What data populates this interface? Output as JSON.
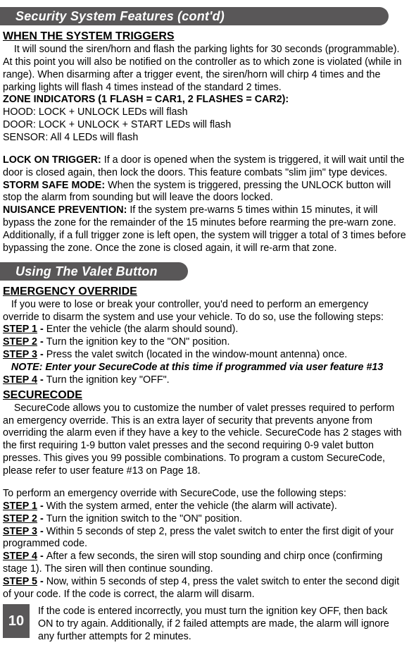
{
  "band1": {
    "title": "Security System Features (cont'd)"
  },
  "band2": {
    "title": "Using The Valet Button"
  },
  "trigger": {
    "heading": "WHEN THE SYSTEM TRIGGERS",
    "p1": "    It will sound the siren/horn and flash the parking lights for 30 seconds (programmable). At this point you will also be notified on the controller as to which zone is violated (while in range). When disarming after a trigger event, the siren/horn will chirp 4 times and the parking lights will flash 4 times instead of the standard 2 times.",
    "zoneLabel": "ZONE INDICATORS (1 FLASH = CAR1, 2 FLASHES = CAR2):",
    "hood": "HOOD: LOCK + UNLOCK LEDs will flash",
    "door": "DOOR: LOCK + UNLOCK + START LEDs will flash",
    "sensor": "SENSOR: All 4 LEDs will flash",
    "lotLabel": "LOCK ON TRIGGER: ",
    "lotText": "If a door is opened when the system is triggered, it will wait until the door is closed again, then lock the doors. This feature combats \"slim jim\" type devices.",
    "ssLabel": "STORM SAFE MODE: ",
    "ssText": "When the system is triggered, pressing the UNLOCK button will stop the alarm from sounding but will leave the doors locked.",
    "npLabel": "NUISANCE PREVENTION: ",
    "npText": "If the system pre-warns 5 times within 15 minutes, it will bypass the zone for the remainder of the 15 minutes before rearming the pre-warn zone. Additionally, if a full trigger zone is left open, the system will trigger a total of 3 times before bypassing the zone. Once the zone is closed again, it will re-arm that zone."
  },
  "override": {
    "heading": "EMERGENCY OVERRIDE",
    "intro": "   If you were to lose or break your controller, you'd need to perform an emergency override to disarm the system and use your vehicle. To do so, use the following steps:",
    "s1a": "STEP 1",
    "s1b": " - ",
    "s1c": "Enter the vehicle (the alarm should sound).",
    "s2a": "STEP 2",
    "s2b": " - ",
    "s2c": "Turn the ignition key to the \"ON\" position.",
    "s3a": "STEP 3",
    "s3b": " - ",
    "s3c": "Press the valet switch (located in the window-mount antenna) once.",
    "note": "   NOTE: Enter your SecureCode at this time if programmed via user feature #13",
    "s4a": "STEP 4",
    "s4b": " - ",
    "s4c": "Turn the ignition key \"OFF\"."
  },
  "sc": {
    "heading": "SECURECODE",
    "p1": "    SecureCode allows you to customize the number of valet presses required to perform an emergency override. This is an extra layer of security that prevents anyone from overriding the alarm even if they have a key to the vehicle. SecureCode has 2 stages with the first requiring 1-9 button valet presses and the second requiring 0-9 valet button presses. This gives you 99 possible combinations. To program a custom SecureCode, please refer to user feature #13 on Page 18.",
    "intro2": "To perform an emergency override with SecureCode, use the following steps:",
    "s1a": "STEP 1",
    "s1b": " - ",
    "s1c": "With the system armed, enter the vehicle (the alarm will activate).",
    "s2a": "STEP 2",
    "s2b": " - ",
    "s2c": "Turn the ignition switch to the \"ON\" position.",
    "s3a": "STEP 3",
    "s3b": " - ",
    "s3c": "Within 5 seconds of step 2, press the valet switch to enter the first digit of your programmed code.",
    "s4a": "STEP 4",
    "s4b": " - ",
    "s4c": "After a few seconds, the siren will stop sounding and chirp once (confirming stage 1). The siren will then continue sounding.",
    "s5a": "STEP 5",
    "s5b": " - ",
    "s5c": "Now, within 5 seconds of step 4, press the valet switch to enter the second digit of your code. If the code is correct, the alarm will disarm."
  },
  "footer": {
    "page": "10",
    "text": "If the code is entered incorrectly, you must turn the ignition key OFF, then back ON to try again. Additionally, if 2 failed attempts are made, the alarm will ignore any further attempts for 2 minutes."
  }
}
